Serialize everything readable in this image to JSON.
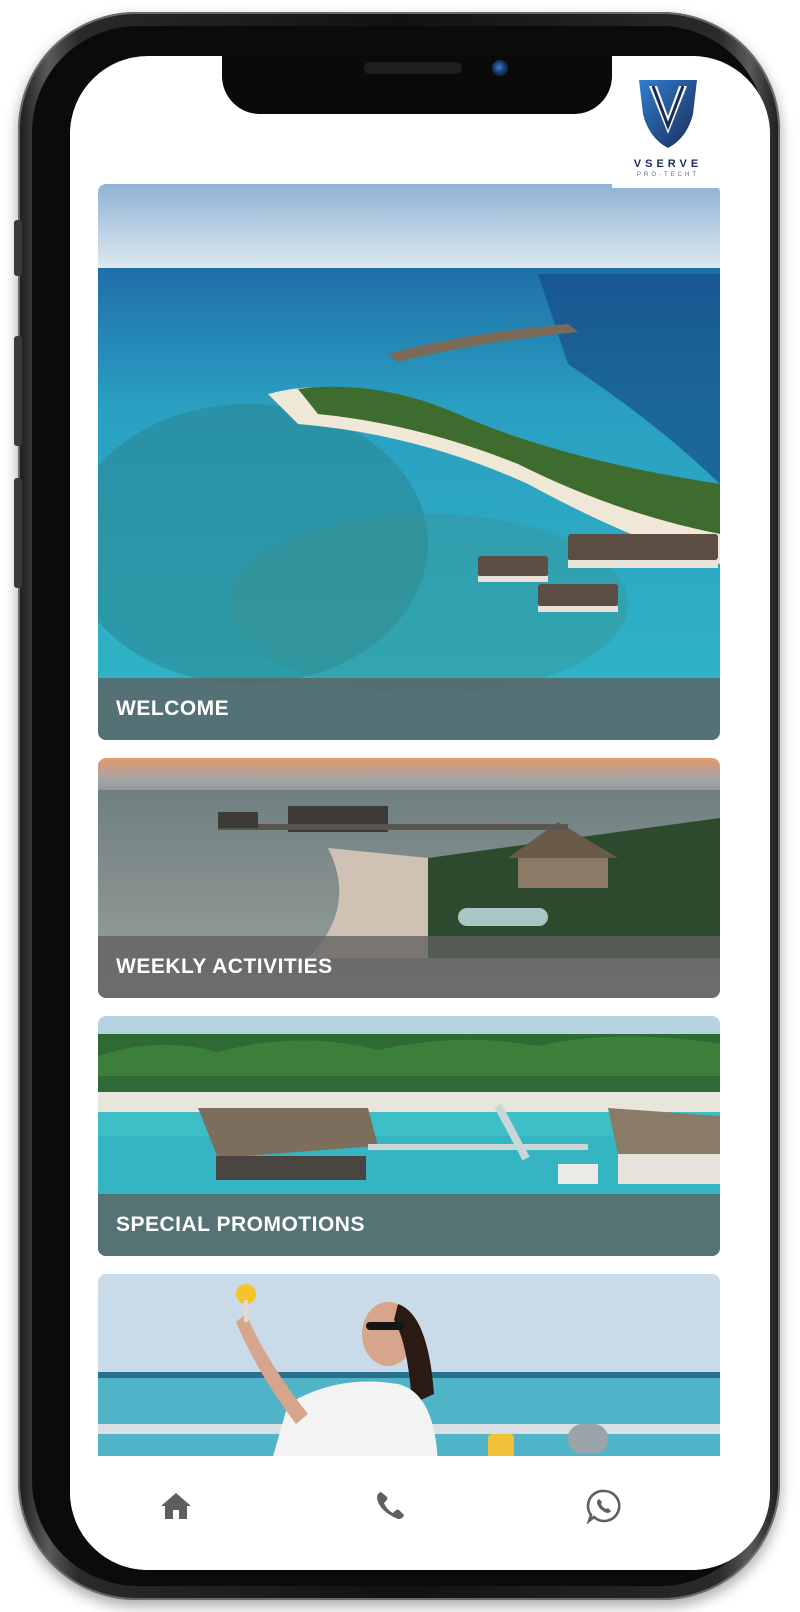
{
  "brand": {
    "name": "VSERVE",
    "tagline": "PRO-TECHT",
    "colors": {
      "primary": "#1b2b55",
      "accent": "#2f7fd0"
    }
  },
  "cards": [
    {
      "label": "WELCOME",
      "image": "maldives-aerial-island"
    },
    {
      "label": "WEEKLY ACTIVITIES",
      "image": "sunset-water-villas"
    },
    {
      "label": "SPECIAL PROMOTIONS",
      "image": "overwater-bungalows"
    },
    {
      "label": "",
      "image": "woman-cocktail-ocean"
    }
  ],
  "tabbar": {
    "items": [
      {
        "icon": "home-icon"
      },
      {
        "icon": "phone-icon"
      },
      {
        "icon": "whatsapp-icon"
      }
    ]
  }
}
